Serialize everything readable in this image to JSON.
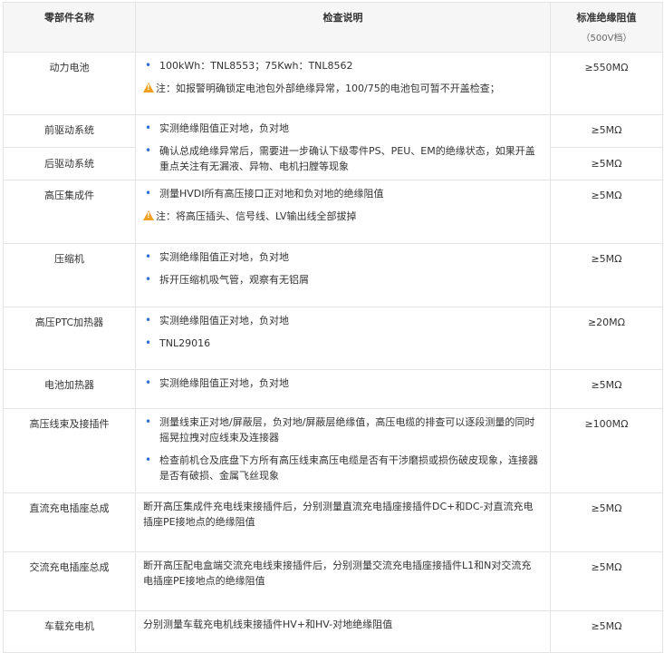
{
  "header": {
    "col_name": "零部件名称",
    "col_check": "检查说明",
    "col_standard": "标准绝缘阻值",
    "col_standard_sub": "（500V档）"
  },
  "rows": [
    {
      "name": "动力电池",
      "items": [
        "100kWh：TNL8553；75Kwh：TNL8562"
      ],
      "note": "注：如报警明确锁定电池包外部绝缘异常，100/75的电池包可暂不开盖检查；",
      "value": "≥550MΩ"
    },
    {
      "name": "前驱动系统",
      "name2": "后驱动系统",
      "items": [
        "实测绝缘阻值正对地，负对地",
        "确认总成绝缘异常后，需要进一步确认下级零件PS、PEU、EM的绝缘状态，如果开盖重点关注有无漏液、异物、电机扫膛等现象"
      ],
      "value": "≥5MΩ",
      "value2": "≥5MΩ"
    },
    {
      "name": "高压集成件",
      "items": [
        "测量HVDI所有高压接口正对地和负对地的绝缘阻值"
      ],
      "note": "注：将高压插头、信号线、LV输出线全部拔掉",
      "value": "≥5MΩ"
    },
    {
      "name": "压缩机",
      "items": [
        "实测绝缘阻值正对地，负对地",
        "拆开压缩机吸气管，观察有无铝屑"
      ],
      "value": "≥5MΩ"
    },
    {
      "name": "高压PTC加热器",
      "items": [
        "实测绝缘阻值正对地，负对地",
        "TNL29016"
      ],
      "value": "≥20MΩ"
    },
    {
      "name": "电池加热器",
      "items": [
        "实测绝缘阻值正对地，负对地"
      ],
      "value": "≥5MΩ"
    },
    {
      "name": "高压线束及接插件",
      "items": [
        "测量线束正对地/屏蔽层，负对地/屏蔽层绝缘值，高压电缆的排查可以逐段测量的同时摇晃拉拽对应线束及连接器",
        "检查前机仓及底盘下方所有高压线束高压电缆是否有干涉磨损或损伤破皮现象，连接器是否有破损、金属飞丝现象"
      ],
      "value": "≥100MΩ"
    },
    {
      "name": "直流充电插座总成",
      "text": "断开高压集成件充电线束接插件后，分别测量直流充电插座接插件DC+和DC-对直流充电插座PE接地点的绝缘阻值",
      "value": "≥5MΩ"
    },
    {
      "name": "交流充电插座总成",
      "text": "断开高压配电盒端交流充电线束接插件后，分别测量交流充电插座接插件L1和N对交流充电插座PE接地点的绝缘阻值",
      "value": "≥5MΩ"
    },
    {
      "name": "车载充电机",
      "text": "分别测量车载充电机线束接插件HV+和HV-对地绝缘阻值",
      "value": "≥5MΩ"
    }
  ],
  "icons": {
    "bullet": "bullet-dot",
    "warning": "warning-triangle-icon"
  },
  "colors": {
    "bullet": "#2f6fd6",
    "warning": "#f0a020",
    "header_bg": "#f6f6f6",
    "border": "#e4e4e4"
  }
}
